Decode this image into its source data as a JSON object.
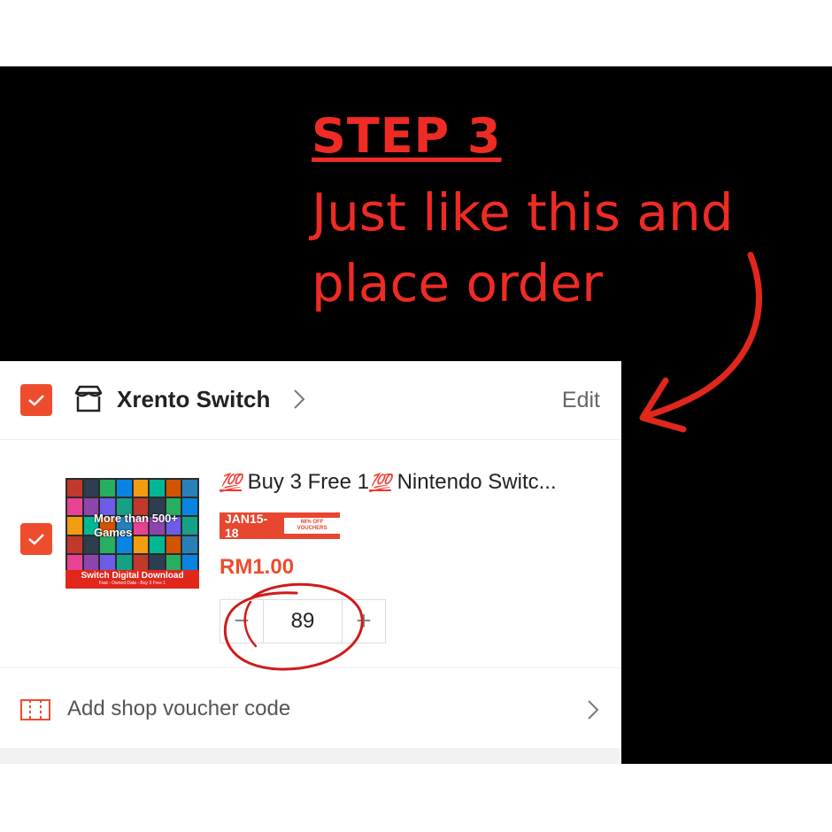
{
  "overlay": {
    "step_title": "STEP 3",
    "step_text": "Just like this and place order",
    "accent_color": "#ee2b24"
  },
  "shop": {
    "name": "Xrento Switch",
    "edit_label": "Edit",
    "icon": "store-icon",
    "checked": true
  },
  "product": {
    "title_prefix_emoji": "💯",
    "title_part1": "Buy 3 Free 1",
    "title_emoji2": "💯",
    "title_part2": "Nintendo Switc...",
    "thumb_overlay": "More than 500+ Games",
    "thumb_banner": "Switch Digital Download",
    "thumb_sub": "Fast - Owned Data - Buy 3 Free 1",
    "voucher_date": "JAN15-18",
    "voucher_badge": "68% OFF VOUCHERS",
    "price": "RM1.00",
    "quantity": "89",
    "minus_label": "−",
    "plus_label": "+",
    "checked": true
  },
  "voucher_row": {
    "label": "Add shop voucher code",
    "icon": "ticket-icon"
  },
  "colors": {
    "brand": "#ee4d2d"
  }
}
